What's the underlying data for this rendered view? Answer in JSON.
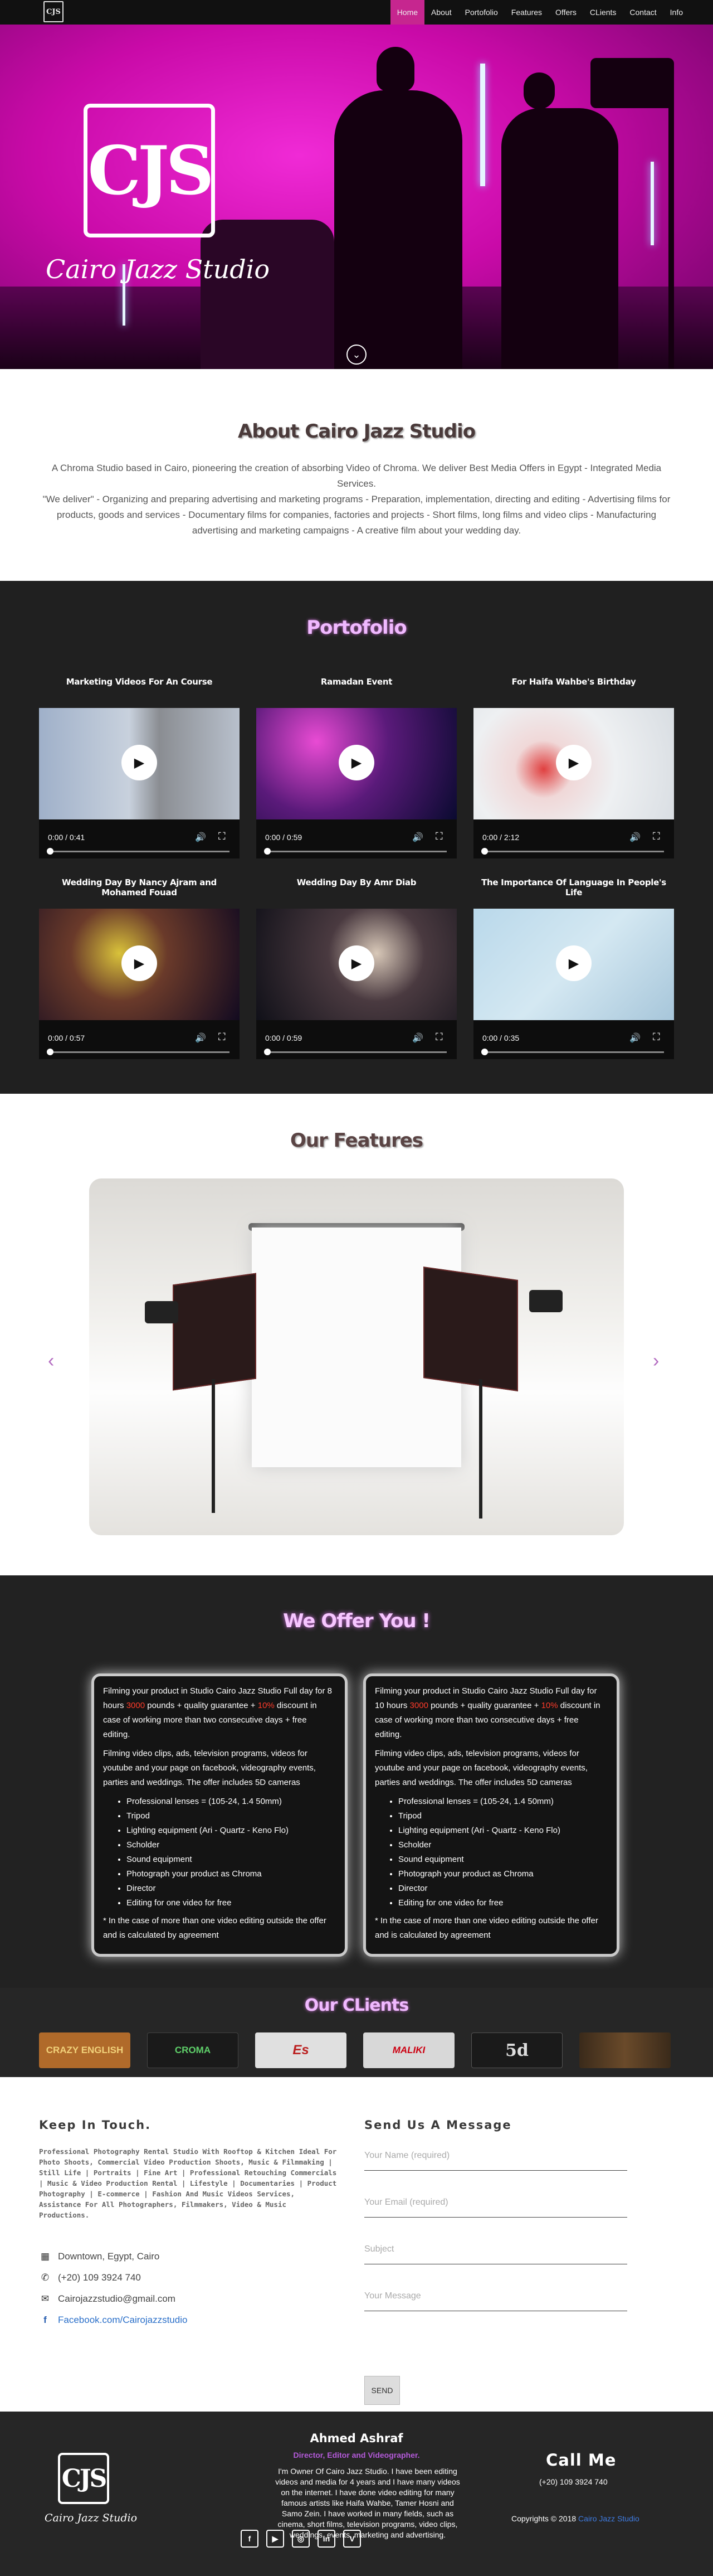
{
  "nav": {
    "logo": "CJS",
    "items": [
      "Home",
      "About",
      "Portofolio",
      "Features",
      "Offers",
      "CLients",
      "Contact",
      "Info"
    ],
    "active": "Home"
  },
  "hero": {
    "logo_letters": "CJS",
    "brand": "Cairo Jazz Studio"
  },
  "about": {
    "title": "About Cairo Jazz Studio",
    "p1": "A Chroma Studio based in Cairo, pioneering the creation of absorbing Video of Chroma. We deliver Best Media Offers in Egypt - Integrated Media Services.",
    "p2": "\"We deliver\" - Organizing and preparing advertising and marketing programs - Preparation, implementation, directing and editing - Advertising films for products, goods and services - Documentary films for companies, factories and projects - Short films, long films and video clips - Manufacturing advertising and marketing campaigns - A creative film about your wedding day."
  },
  "portfolio": {
    "title": "Portofolio",
    "videos": [
      {
        "title": "Marketing Videos For An Course",
        "time": "0:00 / 0:41"
      },
      {
        "title": "Ramadan Event",
        "time": "0:00 / 0:59"
      },
      {
        "title": "For Haifa Wahbe's Birthday",
        "time": "0:00 / 2:12"
      },
      {
        "title": "Wedding Day By Nancy Ajram and Mohamed Fouad",
        "time": "0:00 / 0:57"
      },
      {
        "title": "Wedding Day By Amr Diab",
        "time": "0:00 / 0:59"
      },
      {
        "title": "The Importance Of Language In People's Life",
        "time": "0:00 / 0:35"
      }
    ]
  },
  "features": {
    "title": "Our Features",
    "slide_count": 7,
    "active_slide": 6
  },
  "offers": {
    "title": "We Offer You !",
    "cards": [
      {
        "intro_a": "Filming your product in Studio Cairo Jazz Studio Full day for 8 hours ",
        "price": "3000",
        "intro_b": " pounds + quality guarantee + ",
        "discount": "10%",
        "intro_c": " discount in case of working more than two consecutive days + free editing.",
        "desc": "Filming video clips, ads, television programs, videos for youtube and your page on facebook, videography events, parties and weddings. The offer includes 5D cameras",
        "items": [
          "Professional lenses = (105-24, 1.4 50mm)",
          "Tripod",
          "Lighting equipment (Ari - Quartz - Keno Flo)",
          "Scholder",
          "Sound equipment",
          "Photograph your product as Chroma",
          "Director",
          "Editing for one video for free"
        ],
        "note": "* In the case of more than one video editing outside the offer and is calculated by agreement"
      },
      {
        "intro_a": "Filming your product in Studio Cairo Jazz Studio Full day for 10 hours ",
        "price": "3000",
        "intro_b": " pounds + quality guarantee + ",
        "discount": "10%",
        "intro_c": " discount in case of working more than two consecutive days + free editing.",
        "desc": "Filming video clips, ads, television programs, videos for youtube and your page on facebook, videography events, parties and weddings. The offer includes 5D cameras",
        "items": [
          "Professional lenses = (105-24, 1.4 50mm)",
          "Tripod",
          "Lighting equipment (Ari - Quartz - Keno Flo)",
          "Scholder",
          "Sound equipment",
          "Photograph your product as Chroma",
          "Director",
          "Editing for one video for free"
        ],
        "note": "* In the case of more than one video editing outside the offer and is calculated by agreement"
      }
    ]
  },
  "clients": {
    "title": "Our CLients",
    "logos": [
      "CRAZY ENGLISH",
      "CROMA",
      "Es",
      "MALIKI",
      "5d",
      ""
    ]
  },
  "contact": {
    "keep_title": "Keep In Touch.",
    "description": "Professional Photography Rental Studio With Rooftop & Kitchen Ideal For Photo Shoots, Commercial Video Production Shoots, Music & Filmmaking | Still Life | Portraits | Fine Art | Professional Retouching Commercials | Music & Video Production Rental | Lifestyle | Documentaries | Product Photography | E-commerce | Fashion And Music Videos Services, Assistance For All Photographers, Filmmakers, Video & Music Productions.",
    "address": "Downtown, Egypt, Cairo",
    "phone": "(+20) 109 3924 740",
    "email": "Cairojazzstudio@gmail.com",
    "facebook": "Facebook.com/Cairojazzstudio",
    "send_title": "Send Us A Message",
    "form": {
      "name_placeholder": "Your Name (required)",
      "email_placeholder": "Your Email (required)",
      "subject_placeholder": "Subject",
      "message_placeholder": "Your Message",
      "send": "SEND"
    }
  },
  "footer": {
    "logo_letters": "CJS",
    "brand": "Cairo Jazz Studio",
    "name": "Ahmed Ashraf",
    "role": "Director, Editor and Videographer.",
    "bio": "I'm Owner Of Cairo Jazz Studio. I have been editing videos and media for 4 years and I have many videos on the internet. I have done video editing for many famous artists like Haifa Wahbe, Tamer Hosni and Samo Zein. I have worked in many fields, such as cinema, short films, television programs, video clips, weddings, events, marketing and advertising.",
    "call_me": "Call Me",
    "phone": "(+20) 109 3924 740",
    "copyright": "Copyrights © 2018 ",
    "copyright_link": "Cairo Jazz Studio",
    "social": [
      "f",
      "▶",
      "◎",
      "in",
      "V"
    ]
  }
}
